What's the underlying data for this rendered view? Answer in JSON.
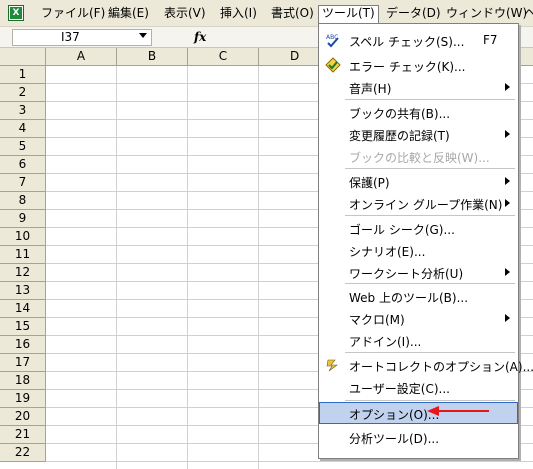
{
  "menubar": {
    "items": [
      "ファイル(F)",
      "編集(E)",
      "表示(V)",
      "挿入(I)",
      "書式(O)",
      "ツール(T)",
      "データ(D)",
      "ウィンドウ(W)",
      "ヘ"
    ]
  },
  "formula_bar": {
    "name_box": "I37",
    "fx": "fx"
  },
  "columns": [
    "A",
    "B",
    "C",
    "D"
  ],
  "rows": [
    "1",
    "2",
    "3",
    "4",
    "5",
    "6",
    "7",
    "8",
    "9",
    "10",
    "11",
    "12",
    "13",
    "14",
    "15",
    "16",
    "17",
    "18",
    "19",
    "20",
    "21",
    "22"
  ],
  "tools_menu": {
    "items": [
      {
        "label": "スペル チェック(S)...",
        "shortcut": "F7",
        "icon": "spell-check-icon"
      },
      {
        "label": "エラー チェック(K)...",
        "icon": "error-check-icon"
      },
      {
        "label": "音声(H)",
        "submenu": true
      },
      {
        "label": "ブックの共有(B)..."
      },
      {
        "label": "変更履歴の記録(T)",
        "submenu": true
      },
      {
        "label": "ブックの比較と反映(W)...",
        "disabled": true
      },
      {
        "label": "保護(P)",
        "submenu": true
      },
      {
        "label": "オンライン グループ作業(N)",
        "submenu": true
      },
      {
        "label": "ゴール シーク(G)..."
      },
      {
        "label": "シナリオ(E)..."
      },
      {
        "label": "ワークシート分析(U)",
        "submenu": true
      },
      {
        "label": "Web 上のツール(B)..."
      },
      {
        "label": "マクロ(M)",
        "submenu": true
      },
      {
        "label": "アドイン(I)..."
      },
      {
        "label": "オートコレクトのオプション(A)...",
        "icon": "autocorrect-lightning-icon"
      },
      {
        "label": "ユーザー設定(C)..."
      },
      {
        "label": "オプション(O)...",
        "highlighted": true
      },
      {
        "label": "分析ツール(D)..."
      }
    ]
  },
  "colors": {
    "menu_bg": "#ECE9D8",
    "highlight_bg": "#C1D2EE",
    "highlight_border": "#316AC5",
    "annotation_arrow": "#E8151B"
  }
}
